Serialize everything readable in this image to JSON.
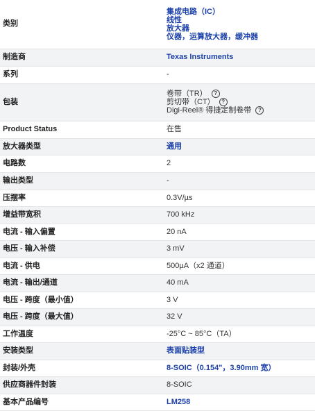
{
  "rows": [
    {
      "label": "类别",
      "lines": [
        "集成电路（IC）",
        "线性",
        "放大器",
        "仪器，运算放大器，缓冲器"
      ]
    },
    {
      "label": "制造商",
      "value": "Texas Instruments"
    },
    {
      "label": "系列",
      "value": "-"
    },
    {
      "label": "包装",
      "lines": [
        "卷带（TR）",
        "剪切带（CT）",
        "Digi-Reel® 得捷定制卷带"
      ]
    },
    {
      "label": "Product Status",
      "value": "在售"
    },
    {
      "label": "放大器类型",
      "value": "通用"
    },
    {
      "label": "电路数",
      "value": "2"
    },
    {
      "label": "输出类型",
      "value": "-"
    },
    {
      "label": "压摆率",
      "value": "0.3V/µs"
    },
    {
      "label": "增益带宽积",
      "value": "700 kHz"
    },
    {
      "label": "电流 - 输入偏置",
      "value": "20 nA"
    },
    {
      "label": "电压 - 输入补偿",
      "value": "3 mV"
    },
    {
      "label": "电流 - 供电",
      "value": "500µA（x2 通道）"
    },
    {
      "label": "电流 - 输出/通道",
      "value": "40 mA"
    },
    {
      "label": "电压 - 跨度（最小值）",
      "value": "3 V"
    },
    {
      "label": "电压 - 跨度（最大值）",
      "value": "32 V"
    },
    {
      "label": "工作温度",
      "value": "-25°C ~ 85°C（TA）"
    },
    {
      "label": "安装类型",
      "value": "表面贴装型"
    },
    {
      "label": "封装/外壳",
      "value": "8-SOIC（0.154\"，3.90mm 宽）"
    },
    {
      "label": "供应商器件封装",
      "value": "8-SOIC"
    },
    {
      "label": "基本产品编号",
      "value": "LM258"
    }
  ],
  "help_icon": "?"
}
